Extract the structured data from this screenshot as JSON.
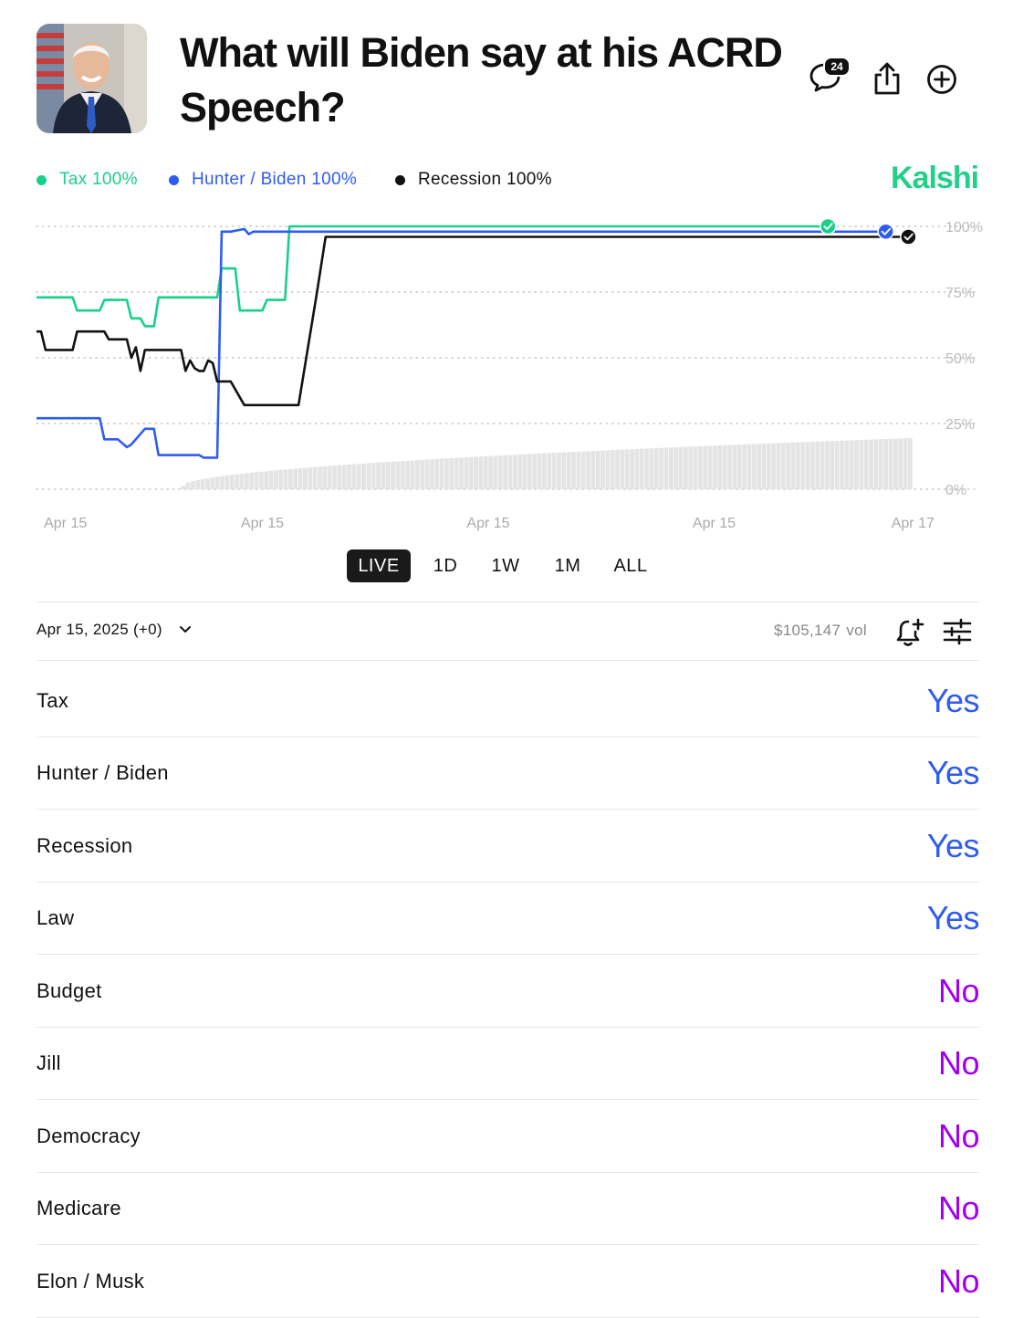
{
  "header": {
    "title": "What will Biden say at his ACRD Speech?",
    "comment_count": "24",
    "brand": "Kalshi",
    "brand_color": "#22d08a"
  },
  "legend": [
    {
      "label": "Tax 100%",
      "color": "#19d08b"
    },
    {
      "label": "Hunter / Biden 100%",
      "color": "#2f5cf0"
    },
    {
      "label": "Recession 100%",
      "color": "#111111"
    }
  ],
  "chart_data": {
    "type": "line",
    "y_tick_labels": [
      "100%",
      "75%",
      "50%",
      "25%",
      "0%"
    ],
    "ylim": [
      0,
      100
    ],
    "x_tick_labels": [
      "Apr 15",
      "Apr 15",
      "Apr 15",
      "Apr 15",
      "Apr 17"
    ],
    "x_ticks_at": [
      0.032,
      0.25,
      0.5,
      0.75,
      0.97
    ],
    "grid": true,
    "legend_position": "top-left",
    "series": [
      {
        "name": "Tax",
        "color": "#19d08b",
        "x": [
          0,
          0.04,
          0.045,
          0.07,
          0.075,
          0.1,
          0.105,
          0.115,
          0.12,
          0.13,
          0.135,
          0.14,
          0.175,
          0.2,
          0.205,
          0.22,
          0.225,
          0.25,
          0.255,
          0.275,
          0.28,
          0.29,
          0.295,
          0.3,
          0.4,
          0.8
        ],
        "y": [
          73,
          73,
          68,
          68,
          72,
          72,
          65,
          65,
          62,
          62,
          73,
          73,
          73,
          73,
          84,
          84,
          68,
          68,
          72,
          72,
          100,
          100,
          100,
          100,
          100,
          100
        ]
      },
      {
        "name": "Hunter / Biden",
        "color": "#2f5cf0",
        "x": [
          0,
          0.07,
          0.075,
          0.09,
          0.1,
          0.105,
          0.12,
          0.13,
          0.135,
          0.18,
          0.185,
          0.2,
          0.205,
          0.21,
          0.215,
          0.23,
          0.235,
          0.24,
          0.25,
          0.26,
          0.27,
          0.5,
          0.8
        ],
        "y": [
          27,
          27,
          19,
          19,
          16,
          17,
          23,
          23,
          13,
          13,
          12,
          12,
          98,
          98,
          98,
          99,
          97,
          98,
          98,
          98,
          98,
          98,
          98
        ]
      },
      {
        "name": "Recession",
        "color": "#111111",
        "x": [
          0,
          0.005,
          0.01,
          0.04,
          0.045,
          0.075,
          0.08,
          0.1,
          0.105,
          0.11,
          0.115,
          0.12,
          0.125,
          0.13,
          0.16,
          0.165,
          0.17,
          0.175,
          0.18,
          0.185,
          0.19,
          0.195,
          0.2,
          0.21,
          0.215,
          0.23,
          0.235,
          0.29,
          0.31,
          0.32,
          0.5,
          0.8
        ],
        "y": [
          60,
          60,
          53,
          53,
          60,
          60,
          57,
          57,
          50,
          54,
          45,
          53,
          53,
          53,
          53,
          45,
          49,
          46,
          45,
          45,
          49,
          48,
          41,
          41,
          41,
          32,
          32,
          32,
          74,
          96,
          96,
          96
        ]
      }
    ],
    "volume_bars": true
  },
  "range_buttons": [
    "LIVE",
    "1D",
    "1W",
    "1M",
    "ALL"
  ],
  "date_row": {
    "date": "Apr 15, 2025 (+0)",
    "volume": "$105,147",
    "volume_unit": "vol"
  },
  "outcomes": [
    {
      "name": "Tax",
      "result": "Yes",
      "color": "#2f5cf0"
    },
    {
      "name": "Hunter / Biden",
      "result": "Yes",
      "color": "#2f5cf0"
    },
    {
      "name": "Recession",
      "result": "Yes",
      "color": "#2f5cf0"
    },
    {
      "name": "Law",
      "result": "Yes",
      "color": "#2f5cf0"
    },
    {
      "name": "Budget",
      "result": "No",
      "color": "#a100ee"
    },
    {
      "name": "Jill",
      "result": "No",
      "color": "#a100ee"
    },
    {
      "name": "Democracy",
      "result": "No",
      "color": "#a100ee"
    },
    {
      "name": "Medicare",
      "result": "No",
      "color": "#a100ee"
    },
    {
      "name": "Elon / Musk",
      "result": "No",
      "color": "#a100ee"
    }
  ]
}
